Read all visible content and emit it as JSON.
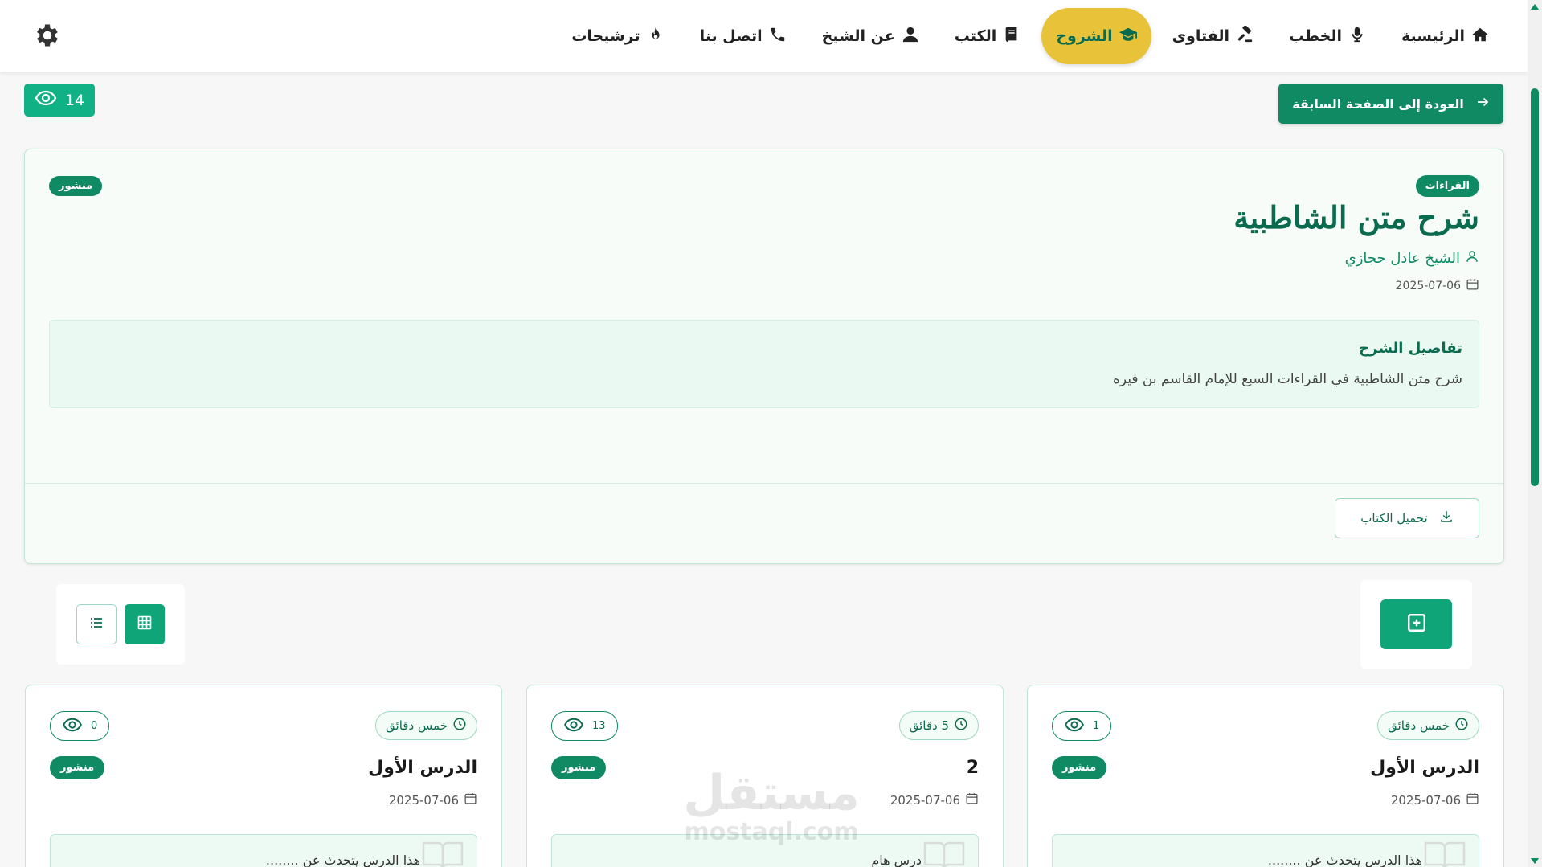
{
  "navbar": {
    "items": [
      {
        "label": "الرئيسية",
        "icon": "home-icon"
      },
      {
        "label": "الخطب",
        "icon": "microphone-icon"
      },
      {
        "label": "الفتاوى",
        "icon": "gavel-icon"
      },
      {
        "label": "الشروح",
        "icon": "graduation-cap-icon",
        "active": true
      },
      {
        "label": "الكتب",
        "icon": "book-icon"
      },
      {
        "label": "عن الشيخ",
        "icon": "user-icon"
      },
      {
        "label": "اتصل بنا",
        "icon": "phone-icon"
      },
      {
        "label": "ترشيحات",
        "icon": "fire-icon"
      }
    ],
    "settings_icon": "gear-icon",
    "active_color": "#e8c33a"
  },
  "top": {
    "back_label": "العودة إلى الصفحة السابقة",
    "views_count": "14"
  },
  "sharh": {
    "category": "القراءات",
    "status": "منشور",
    "title": "شرح متن الشاطبية",
    "author": "الشيخ عادل حجازي",
    "date": "2025-07-06",
    "details_title": "تفاصيل الشرح",
    "details_text": "شرح متن الشاطبية في القراءات السبع للإمام القاسم بن فيره",
    "download_label": "تحميل الكتاب"
  },
  "lessons": [
    {
      "duration": "خمس دقائق",
      "views": "1",
      "title": "الدرس الأول",
      "status": "منشور",
      "date": "2025-07-06",
      "description": "هذا الدرس يتحدث عن ........"
    },
    {
      "duration": "5 دقائق",
      "views": "13",
      "title": "2",
      "status": "منشور",
      "date": "2025-07-06",
      "description": "درس هام"
    },
    {
      "duration": "خمس دقائق",
      "views": "0",
      "title": "الدرس الأول",
      "status": "منشور",
      "date": "2025-07-06",
      "description": "هذا الدرس يتحدث عن ........"
    }
  ],
  "watermark": {
    "arabic": "مستقل",
    "latin": "mostaql.com"
  },
  "colors": {
    "primary": "#0f8a63",
    "accent": "#10b185",
    "dark_green": "#0b6b4e"
  }
}
